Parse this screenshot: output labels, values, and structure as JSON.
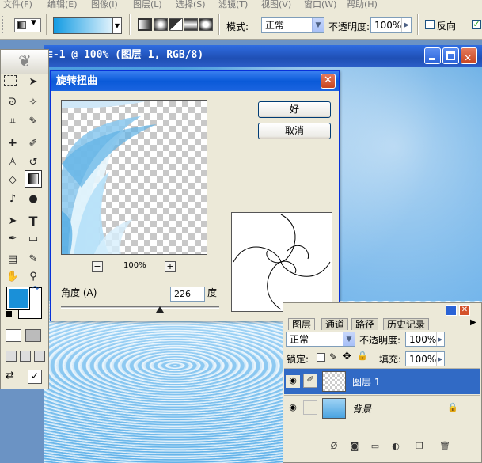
{
  "menu": [
    "文件(F)",
    "编辑(E)",
    "图像(I)",
    "图层(L)",
    "选择(S)",
    "滤镜(T)",
    "视图(V)",
    "窗口(W)",
    "帮助(H)"
  ],
  "options": {
    "mode_label": "模式:",
    "mode_value": "正常",
    "opacity_label": "不透明度:",
    "opacity_value": "100%",
    "reverse_label": "反向",
    "reverse_checked": false
  },
  "document": {
    "title": "≡-1 @ 100% (图层 1, RGB/8)"
  },
  "dialog": {
    "title": "旋转扭曲",
    "ok_label": "好",
    "cancel_label": "取消",
    "zoom_value": "100%",
    "zoom_out": "−",
    "zoom_in": "+",
    "angle_label": "角度 (A)",
    "angle_value": "226",
    "angle_unit": "度",
    "angle_slider_fraction": 0.627
  },
  "layers": {
    "tabs": [
      "图层",
      "通道",
      "路径",
      "历史记录"
    ],
    "blend_mode": "正常",
    "opacity_label": "不透明度:",
    "opacity_value": "100%",
    "lock_label": "锁定:",
    "fill_label": "填充:",
    "fill_value": "100%",
    "rows": [
      {
        "name": "图层 1",
        "selected": true
      },
      {
        "name": "背景",
        "selected": false,
        "locked": true
      }
    ]
  },
  "colors": {
    "foreground": "#1a90d8",
    "background": "#ffffff",
    "xp_title": "#0a5ad8",
    "selection": "#316ac5"
  }
}
